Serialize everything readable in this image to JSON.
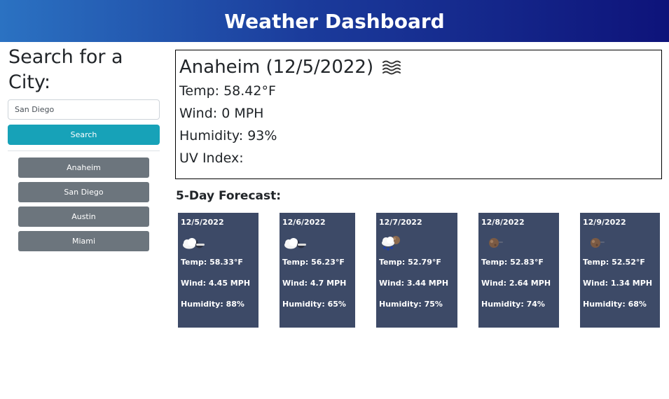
{
  "header": {
    "title": "Weather Dashboard"
  },
  "search": {
    "heading": "Search for a City:",
    "input_value": "San Diego",
    "button_label": "Search"
  },
  "history": [
    "Anaheim",
    "San Diego",
    "Austin",
    "Miami"
  ],
  "current": {
    "title": "Anaheim (12/5/2022)",
    "icon": "mist-icon",
    "temp": "Temp: 58.42°F",
    "wind": "Wind: 0 MPH",
    "humidity": "Humidity: 93%",
    "uv": "UV Index:"
  },
  "forecast": {
    "heading": "5-Day Forecast:",
    "days": [
      {
        "date": "12/5/2022",
        "icon": "partly-cloudy-night-icon",
        "temp": "Temp: 58.33°F",
        "wind": "Wind: 4.45 MPH",
        "humidity": "Humidity: 88%"
      },
      {
        "date": "12/6/2022",
        "icon": "partly-cloudy-night-icon",
        "temp": "Temp: 56.23°F",
        "wind": "Wind: 4.7 MPH",
        "humidity": "Humidity: 65%"
      },
      {
        "date": "12/7/2022",
        "icon": "rain-night-icon",
        "temp": "Temp: 52.79°F",
        "wind": "Wind: 3.44 MPH",
        "humidity": "Humidity: 75%"
      },
      {
        "date": "12/8/2022",
        "icon": "clear-night-icon",
        "temp": "Temp: 52.83°F",
        "wind": "Wind: 2.64 MPH",
        "humidity": "Humidity: 74%"
      },
      {
        "date": "12/9/2022",
        "icon": "clear-night-icon",
        "temp": "Temp: 52.52°F",
        "wind": "Wind: 1.34 MPH",
        "humidity": "Humidity: 68%"
      }
    ]
  },
  "colors": {
    "header_gradient_start": "#2b72c2",
    "header_gradient_end": "#0e137a",
    "search_button": "#17a2b8",
    "history_button": "#6c757d",
    "forecast_card": "#3d4a67"
  }
}
